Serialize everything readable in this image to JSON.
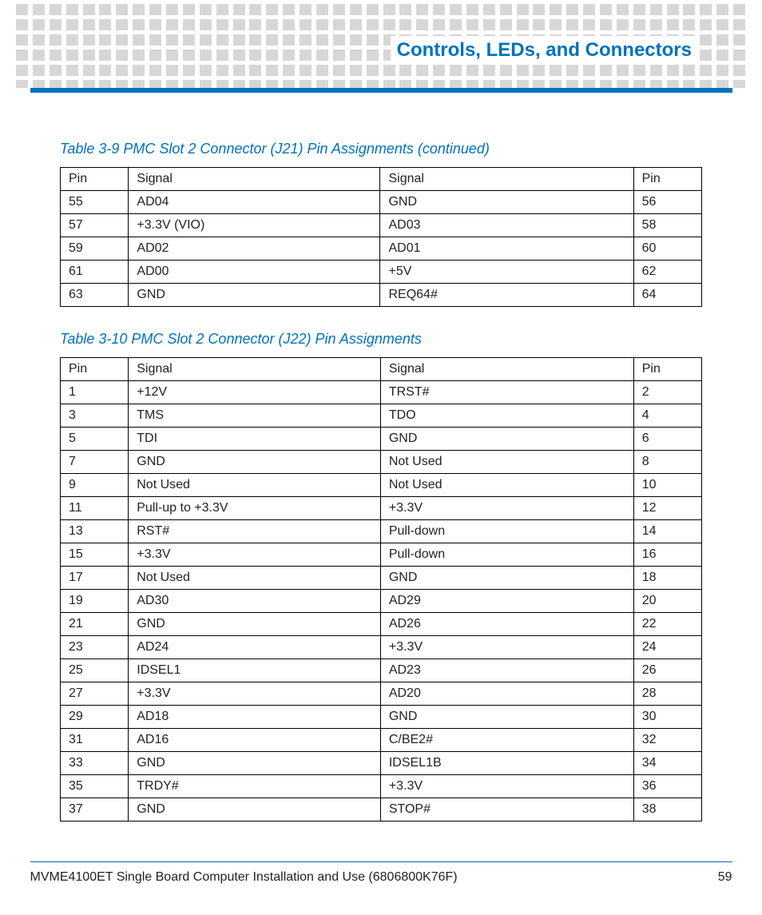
{
  "header": {
    "section_title": "Controls, LEDs, and Connectors"
  },
  "table1": {
    "caption": "Table 3-9 PMC Slot 2 Connector (J21) Pin Assignments (continued)",
    "headers": {
      "pin_l": "Pin",
      "sig_l": "Signal",
      "sig_r": "Signal",
      "pin_r": "Pin"
    },
    "rows": [
      {
        "pin_l": "55",
        "sig_l": "AD04",
        "sig_r": "GND",
        "pin_r": "56"
      },
      {
        "pin_l": "57",
        "sig_l": "+3.3V (VIO)",
        "sig_r": "AD03",
        "pin_r": "58"
      },
      {
        "pin_l": "59",
        "sig_l": "AD02",
        "sig_r": "AD01",
        "pin_r": "60"
      },
      {
        "pin_l": "61",
        "sig_l": "AD00",
        "sig_r": "+5V",
        "pin_r": "62"
      },
      {
        "pin_l": "63",
        "sig_l": "GND",
        "sig_r": "REQ64#",
        "pin_r": "64"
      }
    ]
  },
  "table2": {
    "caption": "Table 3-10 PMC Slot 2 Connector (J22) Pin Assignments",
    "headers": {
      "pin_l": "Pin",
      "sig_l": "Signal",
      "sig_r": "Signal",
      "pin_r": "Pin"
    },
    "rows": [
      {
        "pin_l": "1",
        "sig_l": "+12V",
        "sig_r": "TRST#",
        "pin_r": "2"
      },
      {
        "pin_l": "3",
        "sig_l": "TMS",
        "sig_r": "TDO",
        "pin_r": "4"
      },
      {
        "pin_l": "5",
        "sig_l": "TDI",
        "sig_r": "GND",
        "pin_r": "6"
      },
      {
        "pin_l": "7",
        "sig_l": "GND",
        "sig_r": "Not Used",
        "pin_r": "8"
      },
      {
        "pin_l": "9",
        "sig_l": "Not Used",
        "sig_r": "Not Used",
        "pin_r": "10"
      },
      {
        "pin_l": "11",
        "sig_l": "Pull-up to +3.3V",
        "sig_r": "+3.3V",
        "pin_r": "12"
      },
      {
        "pin_l": "13",
        "sig_l": "RST#",
        "sig_r": "Pull-down",
        "pin_r": "14"
      },
      {
        "pin_l": "15",
        "sig_l": "+3.3V",
        "sig_r": "Pull-down",
        "pin_r": "16"
      },
      {
        "pin_l": "17",
        "sig_l": "Not Used",
        "sig_r": "GND",
        "pin_r": "18"
      },
      {
        "pin_l": "19",
        "sig_l": "AD30",
        "sig_r": "AD29",
        "pin_r": "20"
      },
      {
        "pin_l": "21",
        "sig_l": "GND",
        "sig_r": "AD26",
        "pin_r": "22"
      },
      {
        "pin_l": "23",
        "sig_l": "AD24",
        "sig_r": "+3.3V",
        "pin_r": "24"
      },
      {
        "pin_l": "25",
        "sig_l": "IDSEL1",
        "sig_r": "AD23",
        "pin_r": "26"
      },
      {
        "pin_l": "27",
        "sig_l": "+3.3V",
        "sig_r": "AD20",
        "pin_r": "28"
      },
      {
        "pin_l": "29",
        "sig_l": "AD18",
        "sig_r": "GND",
        "pin_r": "30"
      },
      {
        "pin_l": "31",
        "sig_l": "AD16",
        "sig_r": "C/BE2#",
        "pin_r": "32"
      },
      {
        "pin_l": "33",
        "sig_l": "GND",
        "sig_r": "IDSEL1B",
        "pin_r": "34"
      },
      {
        "pin_l": "35",
        "sig_l": "TRDY#",
        "sig_r": "+3.3V",
        "pin_r": "36"
      },
      {
        "pin_l": "37",
        "sig_l": "GND",
        "sig_r": "STOP#",
        "pin_r": "38"
      }
    ]
  },
  "footer": {
    "doc_title": "MVME4100ET Single Board Computer Installation and Use (6806800K76F)",
    "page_number": "59"
  }
}
